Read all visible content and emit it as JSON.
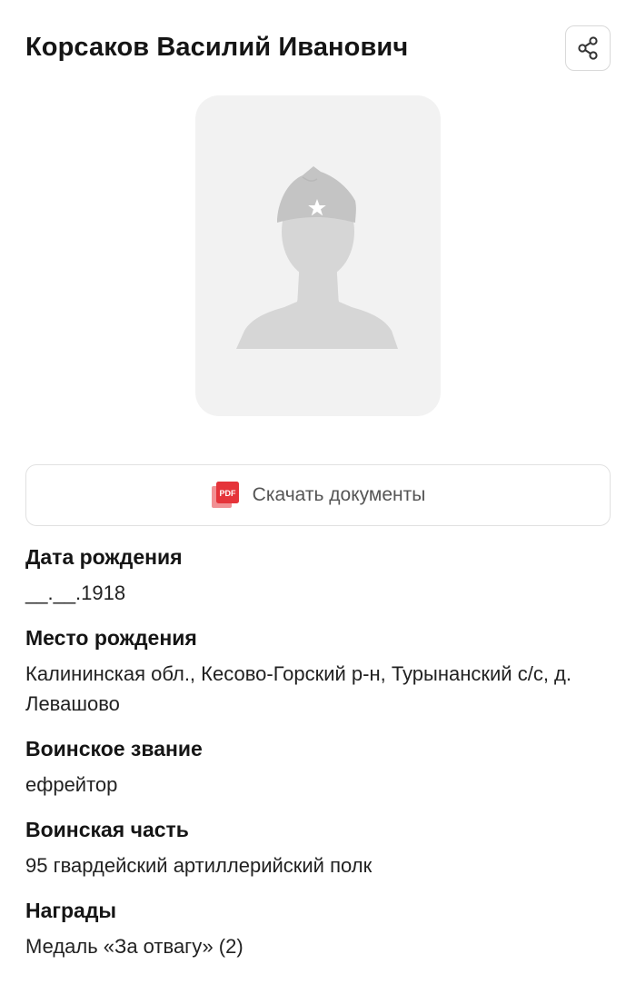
{
  "person": {
    "full_name": "Корсаков Василий Иванович"
  },
  "icons": {
    "share": "share-icon",
    "pdf": "pdf-file-icon",
    "placeholder": "soldier-silhouette-icon"
  },
  "colors": {
    "pdf_red": "#e5343a",
    "placeholder_bg": "#f2f2f2",
    "silhouette": "#d6d6d6"
  },
  "download": {
    "pdf_badge": "PDF",
    "label": "Скачать документы"
  },
  "fields": [
    {
      "label": "Дата рождения",
      "value": "__.__.1918"
    },
    {
      "label": "Место рождения",
      "value": "Калининская обл., Кесово-Горский р-н, Турынанский с/с, д. Левашово"
    },
    {
      "label": "Воинское звание",
      "value": "ефрейтор"
    },
    {
      "label": "Воинская часть",
      "value": "95 гвардейский артиллерийский полк"
    },
    {
      "label": "Награды",
      "value": "Медаль «За отвагу» (2)"
    }
  ]
}
